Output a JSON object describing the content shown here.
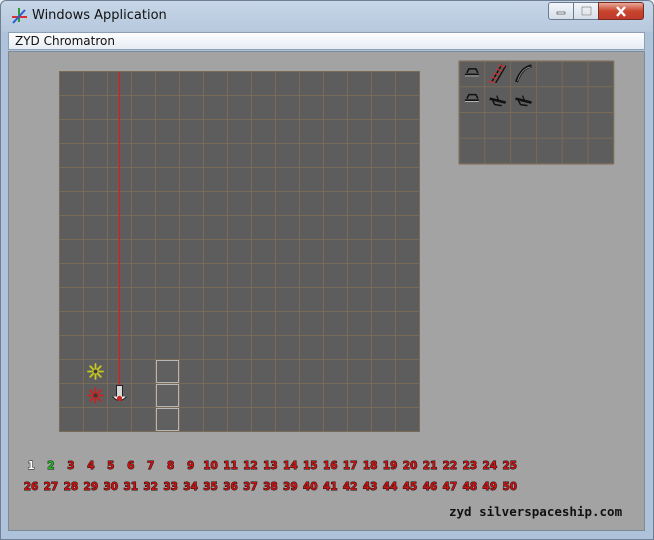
{
  "window": {
    "title": "Windows Application",
    "menu_item": "ZYD Chromatron"
  },
  "game": {
    "grid_cols": 15,
    "grid_rows": 15,
    "palette_cols": 6,
    "palette_rows": 4,
    "laser_color": "#e01a1a",
    "level_color": "#cc1111",
    "level_outline": "#111111",
    "completed_color": "#ffffff",
    "current_color": "#22bb22",
    "board_pieces": [
      {
        "type": "target-star-icon",
        "col": 1,
        "row": 12,
        "color": "#c8c81e"
      },
      {
        "type": "target-star-icon",
        "col": 1,
        "row": 13,
        "color": "#cc2222"
      },
      {
        "type": "laser-emitter-icon",
        "col": 2,
        "row": 13,
        "color": "#cc2222"
      },
      {
        "type": "block-icon",
        "col": 4,
        "row": 12
      },
      {
        "type": "block-icon",
        "col": 4,
        "row": 13
      },
      {
        "type": "block-icon",
        "col": 4,
        "row": 14
      }
    ],
    "palette_pieces": [
      {
        "type": "mirror-icon",
        "col": 0,
        "row": 0
      },
      {
        "type": "ladder-icon",
        "col": 1,
        "row": 0
      },
      {
        "type": "curve-icon",
        "col": 2,
        "row": 0
      },
      {
        "type": "mirror-icon",
        "col": 0,
        "row": 1
      },
      {
        "type": "prism-icon",
        "col": 1,
        "row": 1
      },
      {
        "type": "prism-icon",
        "col": 2,
        "row": 1
      }
    ]
  },
  "levels": {
    "completed": [
      "1"
    ],
    "current": "2",
    "row1": [
      "1",
      "2",
      "3",
      "4",
      "5",
      "6",
      "7",
      "8",
      "9",
      "10",
      "11",
      "12",
      "13",
      "14",
      "15",
      "16",
      "17",
      "18",
      "19",
      "20",
      "21",
      "22",
      "23",
      "24",
      "25"
    ],
    "row2": [
      "26",
      "27",
      "28",
      "29",
      "30",
      "31",
      "32",
      "33",
      "34",
      "35",
      "36",
      "37",
      "38",
      "39",
      "40",
      "41",
      "42",
      "43",
      "44",
      "45",
      "46",
      "47",
      "48",
      "49",
      "50"
    ]
  },
  "credit": "zyd silverspaceship.com"
}
